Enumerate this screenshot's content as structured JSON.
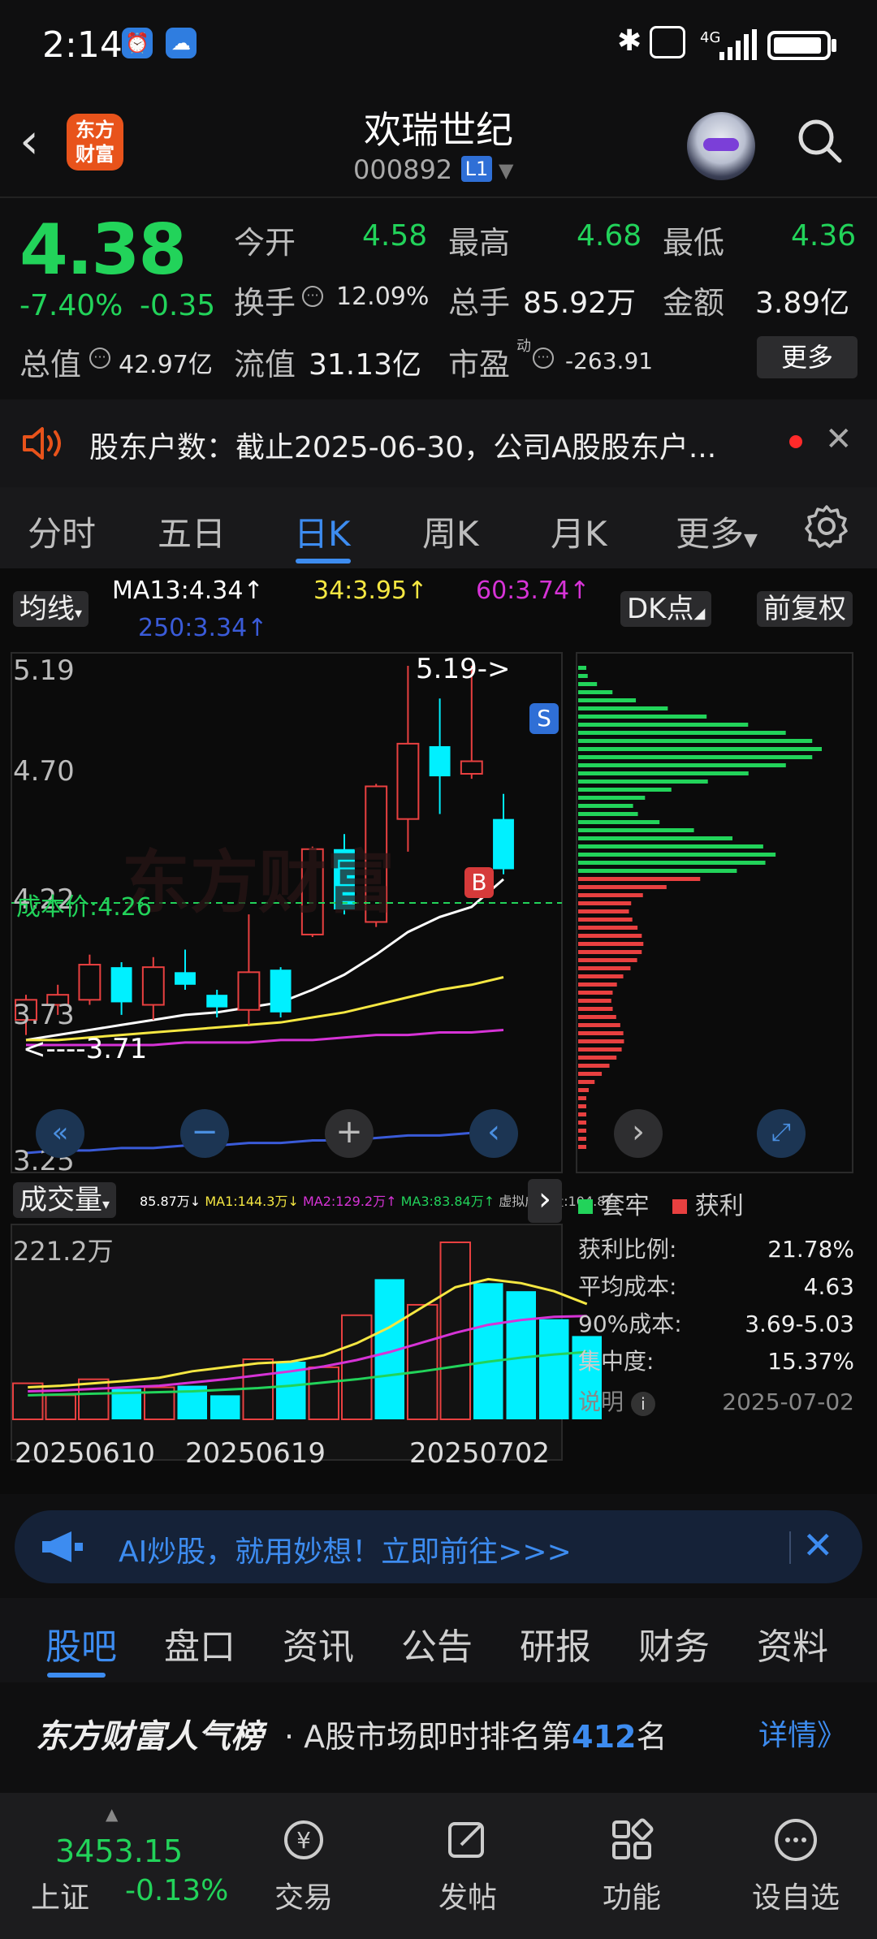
{
  "status_bar": {
    "time": "2:14",
    "network": "4G"
  },
  "header": {
    "logo_text": "东方财富",
    "stock_name": "欢瑞世纪",
    "stock_code": "000892",
    "level_badge": "L1"
  },
  "quote": {
    "price": "4.38",
    "change_pct": "-7.40%",
    "change_val": "-0.35",
    "open_label": "今开",
    "open": "4.58",
    "high_label": "最高",
    "high": "4.68",
    "low_label": "最低",
    "low": "4.36",
    "turnover_label": "换手",
    "turnover": "12.09%",
    "volume_label": "总手",
    "volume": "85.92万",
    "amount_label": "金额",
    "amount": "3.89亿",
    "mktcap_label": "总值",
    "mktcap": "42.97亿",
    "float_label": "流值",
    "float": "31.13亿",
    "pe_label": "市盈",
    "pe_sup": "动",
    "pe": "-263.91",
    "more_label": "更多"
  },
  "announcement": {
    "text": "股东户数：截止2025-06-30，公司A股股东户..."
  },
  "period_tabs": [
    "分时",
    "五日",
    "日K",
    "周K",
    "月K",
    "更多"
  ],
  "active_period": "日K",
  "chart_toolbar": {
    "ma_chip": "均线",
    "ma13": "MA13:4.34↑",
    "ma34": "34:3.95↑",
    "ma60": "60:3.74↑",
    "ma250": "250:3.34↑",
    "dk_chip": "DK点",
    "adjust_chip": "前复权"
  },
  "chart_labels": {
    "y_ticks": [
      "5.19",
      "4.70",
      "4.22",
      "3.73",
      "3.25"
    ],
    "high_marker": "5.19->",
    "low_marker": "<----3.71",
    "cost_line": "成本价:4.26",
    "sell_marker": "S",
    "buy_marker": "B",
    "watermark": "东方财富"
  },
  "volume_panel": {
    "chip": "成交量",
    "indicator_line": [
      "85.87万↓",
      "MA1:144.3万↓",
      "MA2:129.2万↑",
      "MA3:83.84万↑",
      "虚拟成交量:104.8万"
    ],
    "y_max": "221.2万",
    "dates": [
      "20250610",
      "20250619",
      "20250702"
    ]
  },
  "chip_distribution": {
    "legend": [
      "套牢",
      "获利"
    ],
    "stats": [
      {
        "label": "获利比例:",
        "value": "21.78%"
      },
      {
        "label": "平均成本:",
        "value": "4.63"
      },
      {
        "label": "90%成本:",
        "value": "3.69-5.03"
      },
      {
        "label": "集中度:",
        "value": "15.37%"
      }
    ],
    "note_label": "说明",
    "date": "2025-07-02"
  },
  "chart_data": {
    "type": "candlestick",
    "ylim": [
      3.25,
      5.19
    ],
    "candles": [
      {
        "o": 3.78,
        "c": 3.86,
        "h": 3.88,
        "l": 3.72,
        "dir": "up"
      },
      {
        "o": 3.84,
        "c": 3.88,
        "h": 3.92,
        "l": 3.8,
        "dir": "up"
      },
      {
        "o": 3.86,
        "c": 4.0,
        "h": 4.04,
        "l": 3.84,
        "dir": "up"
      },
      {
        "o": 3.99,
        "c": 3.85,
        "h": 4.01,
        "l": 3.8,
        "dir": "down"
      },
      {
        "o": 3.84,
        "c": 3.99,
        "h": 4.03,
        "l": 3.78,
        "dir": "up"
      },
      {
        "o": 3.97,
        "c": 3.92,
        "h": 4.06,
        "l": 3.9,
        "dir": "down"
      },
      {
        "o": 3.88,
        "c": 3.83,
        "h": 3.9,
        "l": 3.79,
        "dir": "down"
      },
      {
        "o": 3.82,
        "c": 3.97,
        "h": 4.2,
        "l": 3.76,
        "dir": "up"
      },
      {
        "o": 3.98,
        "c": 3.81,
        "h": 3.99,
        "l": 3.79,
        "dir": "down"
      },
      {
        "o": 4.12,
        "c": 4.46,
        "h": 4.47,
        "l": 4.11,
        "dir": "up"
      },
      {
        "o": 4.46,
        "c": 4.22,
        "h": 4.52,
        "l": 4.2,
        "dir": "down"
      },
      {
        "o": 4.17,
        "c": 4.71,
        "h": 4.72,
        "l": 4.15,
        "dir": "up"
      },
      {
        "o": 4.58,
        "c": 4.88,
        "h": 5.19,
        "l": 4.45,
        "dir": "up"
      },
      {
        "o": 4.87,
        "c": 4.75,
        "h": 5.06,
        "l": 4.6,
        "dir": "down"
      },
      {
        "o": 4.76,
        "c": 4.81,
        "h": 5.19,
        "l": 4.74,
        "dir": "down"
      },
      {
        "o": 4.58,
        "c": 4.38,
        "h": 4.68,
        "l": 4.36,
        "dir": "down"
      }
    ],
    "volume": [
      45,
      30,
      50,
      38,
      40,
      42,
      30,
      75,
      72,
      65,
      130,
      175,
      143,
      221,
      170,
      160,
      125,
      104
    ],
    "volume_dir": [
      "up",
      "up",
      "up",
      "down",
      "up",
      "down",
      "down",
      "up",
      "down",
      "up",
      "up",
      "down",
      "up",
      "up",
      "down",
      "down",
      "down",
      "down"
    ],
    "series": [
      {
        "name": "MA13",
        "color": "#ffffff"
      },
      {
        "name": "MA34",
        "color": "#f5e742"
      },
      {
        "name": "MA60",
        "color": "#d633d6"
      },
      {
        "name": "MA250",
        "color": "#3a5bd8"
      }
    ]
  },
  "ad": {
    "text": "AI炒股，就用妙想！立即前往>>>"
  },
  "bottom_tabs": [
    "股吧",
    "盘口",
    "资讯",
    "公告",
    "研报",
    "财务",
    "资料"
  ],
  "popularity": {
    "brand": "东方财富人气榜",
    "text_pre": "· A股市场即时排名第",
    "rank": "412",
    "text_post": "名",
    "detail": "详情》"
  },
  "bottom_nav": {
    "index_value": "3453.15",
    "index_name": "上证",
    "index_change": "-0.13%",
    "items": [
      "交易",
      "发帖",
      "功能",
      "设自选"
    ]
  },
  "colors": {
    "up": "#e84040",
    "down": "#22d35a",
    "accent": "#3d8cf0",
    "cyan": "#00f0ff"
  }
}
